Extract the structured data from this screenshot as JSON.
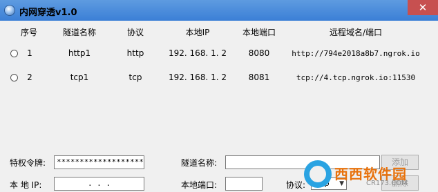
{
  "window": {
    "title": "内网穿透v1.0",
    "close_glyph": "✕"
  },
  "table": {
    "headers": [
      "序号",
      "隧道名称",
      "协议",
      "本地IP",
      "本地端口",
      "远程域名/端口"
    ],
    "rows": [
      {
        "index": "1",
        "name": "http1",
        "protocol": "http",
        "ip": "192. 168. 1. 2",
        "port": "8080",
        "remote": "http://794e2018a8b7.ngrok.io"
      },
      {
        "index": "2",
        "name": "tcp1",
        "protocol": "tcp",
        "ip": "192. 168. 1. 2",
        "port": "8081",
        "remote": "tcp://4.tcp.ngrok.io:11530"
      }
    ]
  },
  "form": {
    "token_label": "特权令牌:",
    "token_value": "************************",
    "tunnel_name_label": "隧道名称:",
    "tunnel_name_value": "",
    "local_ip_label": "本 地 IP:",
    "local_ip_value": ".       .       .",
    "local_port_label": "本地端口:",
    "local_port_value": "",
    "protocol_label": "协议:",
    "protocol_value": "http",
    "add_button": "添加",
    "delete_button": "删除"
  },
  "watermark": {
    "brand": "西西软件园",
    "url": "CR173.COM"
  }
}
